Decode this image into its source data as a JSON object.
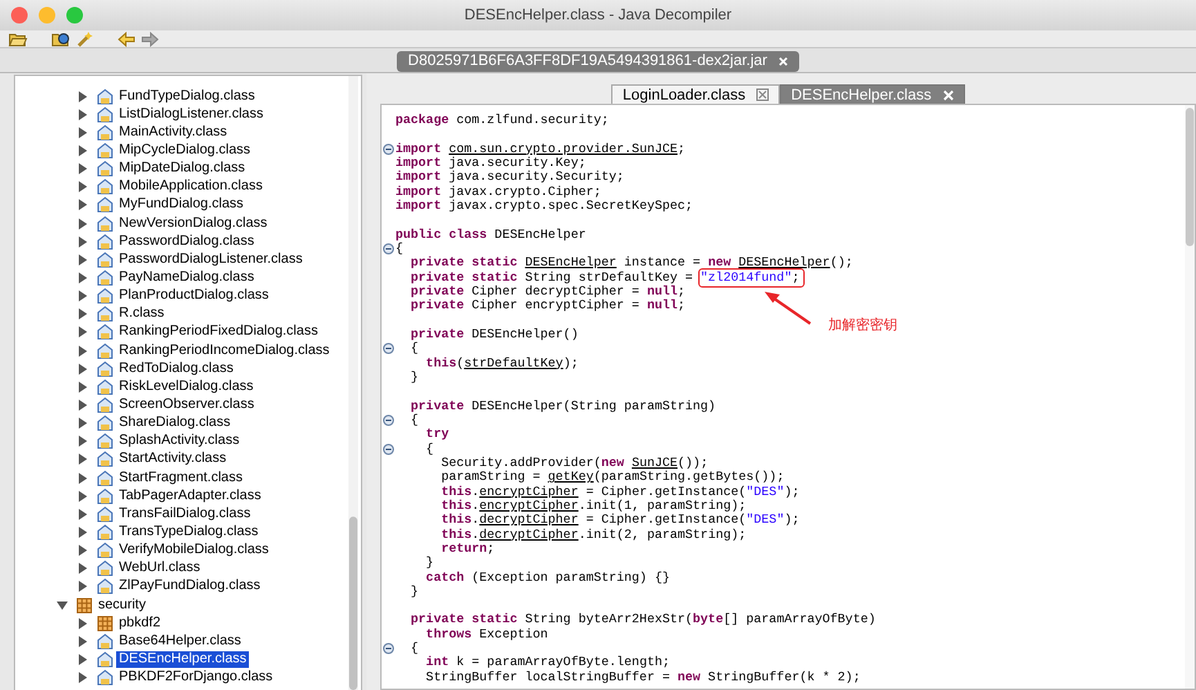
{
  "window": {
    "title": "DESEncHelper.class - Java Decompiler"
  },
  "toolbar": {
    "forward_disabled": true
  },
  "file_tabs": [
    {
      "label": "D8025971B6F6A3FF8DF19A5494391861-dex2jar.jar",
      "selected": true
    }
  ],
  "tree": [
    {
      "kind": "scrolled",
      "children": [
        {
          "label": "FundTypeDialog.class",
          "kind": "class",
          "expanded": false,
          "selected": false
        },
        {
          "label": "ListDialogListener.class",
          "kind": "class",
          "expanded": false,
          "selected": false
        },
        {
          "label": "MainActivity.class",
          "kind": "class",
          "expanded": false,
          "selected": false
        },
        {
          "label": "MipCycleDialog.class",
          "kind": "class",
          "expanded": false,
          "selected": false
        },
        {
          "label": "MipDateDialog.class",
          "kind": "class",
          "expanded": false,
          "selected": false
        },
        {
          "label": "MobileApplication.class",
          "kind": "class",
          "expanded": false,
          "selected": false
        },
        {
          "label": "MyFundDialog.class",
          "kind": "class",
          "expanded": false,
          "selected": false
        },
        {
          "label": "NewVersionDialog.class",
          "kind": "class",
          "expanded": false,
          "selected": false
        },
        {
          "label": "PasswordDialog.class",
          "kind": "class",
          "expanded": false,
          "selected": false
        },
        {
          "label": "PasswordDialogListener.class",
          "kind": "class",
          "expanded": false,
          "selected": false
        },
        {
          "label": "PayNameDialog.class",
          "kind": "class",
          "expanded": false,
          "selected": false
        },
        {
          "label": "PlanProductDialog.class",
          "kind": "class",
          "expanded": false,
          "selected": false
        },
        {
          "label": "R.class",
          "kind": "class",
          "expanded": false,
          "selected": false
        },
        {
          "label": "RankingPeriodFixedDialog.class",
          "kind": "class",
          "expanded": false,
          "selected": false
        },
        {
          "label": "RankingPeriodIncomeDialog.class",
          "kind": "class",
          "expanded": false,
          "selected": false
        },
        {
          "label": "RedToDialog.class",
          "kind": "class",
          "expanded": false,
          "selected": false
        },
        {
          "label": "RiskLevelDialog.class",
          "kind": "class",
          "expanded": false,
          "selected": false
        },
        {
          "label": "ScreenObserver.class",
          "kind": "class",
          "expanded": false,
          "selected": false
        },
        {
          "label": "ShareDialog.class",
          "kind": "class",
          "expanded": false,
          "selected": false
        },
        {
          "label": "SplashActivity.class",
          "kind": "class",
          "expanded": false,
          "selected": false
        },
        {
          "label": "StartActivity.class",
          "kind": "class",
          "expanded": false,
          "selected": false
        },
        {
          "label": "StartFragment.class",
          "kind": "class",
          "expanded": false,
          "selected": false
        },
        {
          "label": "TabPagerAdapter.class",
          "kind": "class",
          "expanded": false,
          "selected": false
        },
        {
          "label": "TransFailDialog.class",
          "kind": "class",
          "expanded": false,
          "selected": false
        },
        {
          "label": "TransTypeDialog.class",
          "kind": "class",
          "expanded": false,
          "selected": false
        },
        {
          "label": "VerifyMobileDialog.class",
          "kind": "class",
          "expanded": false,
          "selected": false
        },
        {
          "label": "WebUrl.class",
          "kind": "class",
          "expanded": false,
          "selected": false
        },
        {
          "label": "ZlPayFundDialog.class",
          "kind": "class",
          "expanded": false,
          "selected": false
        }
      ]
    },
    {
      "label": "security",
      "kind": "package",
      "expanded": true,
      "selected": false,
      "children": [
        {
          "label": "pbkdf2",
          "kind": "package",
          "expanded": false,
          "selected": false
        },
        {
          "label": "Base64Helper.class",
          "kind": "class",
          "expanded": false,
          "selected": false
        },
        {
          "label": "DESEncHelper.class",
          "kind": "class",
          "expanded": false,
          "selected": true
        },
        {
          "label": "PBKDF2ForDjango.class",
          "kind": "class",
          "expanded": false,
          "selected": false
        }
      ]
    }
  ],
  "editor_tabs": [
    {
      "label": "LoginLoader.class",
      "selected": false
    },
    {
      "label": "DESEncHelper.class",
      "selected": true
    }
  ],
  "code_lines": [
    {
      "fold": false,
      "tokens": [
        {
          "kind": "keyword",
          "text": "package"
        },
        {
          "kind": "plain",
          "text": " com.zlfund.security;"
        }
      ]
    },
    {
      "fold": false
    },
    {
      "fold": true,
      "tokens": [
        {
          "kind": "keyword",
          "text": "import "
        },
        {
          "kind": "ref",
          "text": "com.sun.crypto.provider.SunJCE"
        },
        {
          "kind": "plain",
          "text": ";"
        }
      ]
    },
    {
      "fold": false,
      "tokens": [
        {
          "kind": "keyword",
          "text": "import"
        },
        {
          "kind": "plain",
          "text": " java.security.Key;"
        }
      ]
    },
    {
      "fold": false,
      "tokens": [
        {
          "kind": "keyword",
          "text": "import"
        },
        {
          "kind": "plain",
          "text": " java.security.Security;"
        }
      ]
    },
    {
      "fold": false,
      "tokens": [
        {
          "kind": "keyword",
          "text": "import"
        },
        {
          "kind": "plain",
          "text": " javax.crypto.Cipher;"
        }
      ]
    },
    {
      "fold": false,
      "tokens": [
        {
          "kind": "keyword",
          "text": "import"
        },
        {
          "kind": "plain",
          "text": " javax.crypto.spec.SecretKeySpec;"
        }
      ]
    },
    {
      "fold": false
    },
    {
      "fold": false,
      "tokens": [
        {
          "kind": "keyword",
          "text": "public class"
        },
        {
          "kind": "plain",
          "text": " DESEncHelper"
        }
      ]
    },
    {
      "fold": true,
      "tokens": [
        {
          "kind": "plain",
          "text": "{"
        }
      ]
    },
    {
      "fold": false,
      "tokens": [
        {
          "kind": "keyword",
          "text": "  private static "
        },
        {
          "kind": "ref",
          "text": "DESEncHelper"
        },
        {
          "kind": "plain",
          "text": " instance = "
        },
        {
          "kind": "keyword",
          "text": "new "
        },
        {
          "kind": "ref",
          "text": "DESEncHelper"
        },
        {
          "kind": "plain",
          "text": "();"
        }
      ]
    },
    {
      "fold": false,
      "tokens": [
        {
          "kind": "keyword",
          "text": "  private static"
        },
        {
          "kind": "plain",
          "text": " String strDefaultKey = "
        },
        {
          "kind": "string",
          "text": "\"zl2014fund\"",
          "boxed": true
        },
        {
          "kind": "plain",
          "text": ";",
          "boxed": true
        }
      ]
    },
    {
      "fold": false,
      "tokens": [
        {
          "kind": "keyword",
          "text": "  private"
        },
        {
          "kind": "plain",
          "text": " Cipher decryptCipher = "
        },
        {
          "kind": "keyword",
          "text": "null"
        },
        {
          "kind": "plain",
          "text": ";"
        }
      ]
    },
    {
      "fold": false,
      "tokens": [
        {
          "kind": "keyword",
          "text": "  private"
        },
        {
          "kind": "plain",
          "text": " Cipher encryptCipher = "
        },
        {
          "kind": "keyword",
          "text": "null"
        },
        {
          "kind": "plain",
          "text": ";"
        }
      ]
    },
    {
      "fold": false
    },
    {
      "fold": false,
      "tokens": [
        {
          "kind": "keyword",
          "text": "  private"
        },
        {
          "kind": "plain",
          "text": " DESEncHelper()"
        }
      ]
    },
    {
      "fold": true,
      "tokens": [
        {
          "kind": "plain",
          "text": "  {"
        }
      ]
    },
    {
      "fold": false,
      "tokens": [
        {
          "kind": "keyword",
          "text": "    this"
        },
        {
          "kind": "plain",
          "text": "("
        },
        {
          "kind": "ref",
          "text": "strDefaultKey"
        },
        {
          "kind": "plain",
          "text": ");"
        }
      ]
    },
    {
      "fold": false,
      "tokens": [
        {
          "kind": "plain",
          "text": "  }"
        }
      ]
    },
    {
      "fold": false
    },
    {
      "fold": false,
      "tokens": [
        {
          "kind": "keyword",
          "text": "  private"
        },
        {
          "kind": "plain",
          "text": " DESEncHelper(String paramString)"
        }
      ]
    },
    {
      "fold": true,
      "tokens": [
        {
          "kind": "plain",
          "text": "  {"
        }
      ]
    },
    {
      "fold": false,
      "tokens": [
        {
          "kind": "keyword",
          "text": "    try"
        }
      ]
    },
    {
      "fold": true,
      "tokens": [
        {
          "kind": "plain",
          "text": "    {"
        }
      ]
    },
    {
      "fold": false,
      "tokens": [
        {
          "kind": "plain",
          "text": "      Security.addProvider("
        },
        {
          "kind": "keyword",
          "text": "new "
        },
        {
          "kind": "ref",
          "text": "SunJCE"
        },
        {
          "kind": "plain",
          "text": "());"
        }
      ]
    },
    {
      "fold": false,
      "tokens": [
        {
          "kind": "plain",
          "text": "      paramString = "
        },
        {
          "kind": "ref",
          "text": "getKey"
        },
        {
          "kind": "plain",
          "text": "(paramString.getBytes());"
        }
      ]
    },
    {
      "fold": false,
      "tokens": [
        {
          "kind": "keyword",
          "text": "      this"
        },
        {
          "kind": "plain",
          "text": "."
        },
        {
          "kind": "ref",
          "text": "encryptCipher"
        },
        {
          "kind": "plain",
          "text": " = Cipher.getInstance("
        },
        {
          "kind": "string",
          "text": "\"DES\""
        },
        {
          "kind": "plain",
          "text": ");"
        }
      ]
    },
    {
      "fold": false,
      "tokens": [
        {
          "kind": "keyword",
          "text": "      this"
        },
        {
          "kind": "plain",
          "text": "."
        },
        {
          "kind": "ref",
          "text": "encryptCipher"
        },
        {
          "kind": "plain",
          "text": ".init(1, paramString);"
        }
      ]
    },
    {
      "fold": false,
      "tokens": [
        {
          "kind": "keyword",
          "text": "      this"
        },
        {
          "kind": "plain",
          "text": "."
        },
        {
          "kind": "ref",
          "text": "decryptCipher"
        },
        {
          "kind": "plain",
          "text": " = Cipher.getInstance("
        },
        {
          "kind": "string",
          "text": "\"DES\""
        },
        {
          "kind": "plain",
          "text": ");"
        }
      ]
    },
    {
      "fold": false,
      "tokens": [
        {
          "kind": "keyword",
          "text": "      this"
        },
        {
          "kind": "plain",
          "text": "."
        },
        {
          "kind": "ref",
          "text": "decryptCipher"
        },
        {
          "kind": "plain",
          "text": ".init(2, paramString);"
        }
      ]
    },
    {
      "fold": false,
      "tokens": [
        {
          "kind": "keyword",
          "text": "      return"
        },
        {
          "kind": "plain",
          "text": ";"
        }
      ]
    },
    {
      "fold": false,
      "tokens": [
        {
          "kind": "plain",
          "text": "    }"
        }
      ]
    },
    {
      "fold": false,
      "tokens": [
        {
          "kind": "keyword",
          "text": "    catch"
        },
        {
          "kind": "plain",
          "text": " (Exception paramString) {}"
        }
      ]
    },
    {
      "fold": false,
      "tokens": [
        {
          "kind": "plain",
          "text": "  }"
        }
      ]
    },
    {
      "fold": false
    },
    {
      "fold": false,
      "tokens": [
        {
          "kind": "keyword",
          "text": "  private static"
        },
        {
          "kind": "plain",
          "text": " String byteArr2HexStr("
        },
        {
          "kind": "keyword",
          "text": "byte"
        },
        {
          "kind": "plain",
          "text": "[] paramArrayOfByte)"
        }
      ]
    },
    {
      "fold": false,
      "tokens": [
        {
          "kind": "keyword",
          "text": "    throws"
        },
        {
          "kind": "plain",
          "text": " Exception"
        }
      ]
    },
    {
      "fold": true,
      "tokens": [
        {
          "kind": "plain",
          "text": "  {"
        }
      ]
    },
    {
      "fold": false,
      "tokens": [
        {
          "kind": "keyword",
          "text": "    int"
        },
        {
          "kind": "plain",
          "text": " k = paramArrayOfByte.length;"
        }
      ]
    },
    {
      "fold": false,
      "tokens": [
        {
          "kind": "plain",
          "text": "    StringBuffer localStringBuffer = "
        },
        {
          "kind": "keyword",
          "text": "new"
        },
        {
          "kind": "plain",
          "text": " StringBuffer(k * 2);"
        }
      ]
    }
  ],
  "annotation": {
    "note": "加解密密钥"
  }
}
